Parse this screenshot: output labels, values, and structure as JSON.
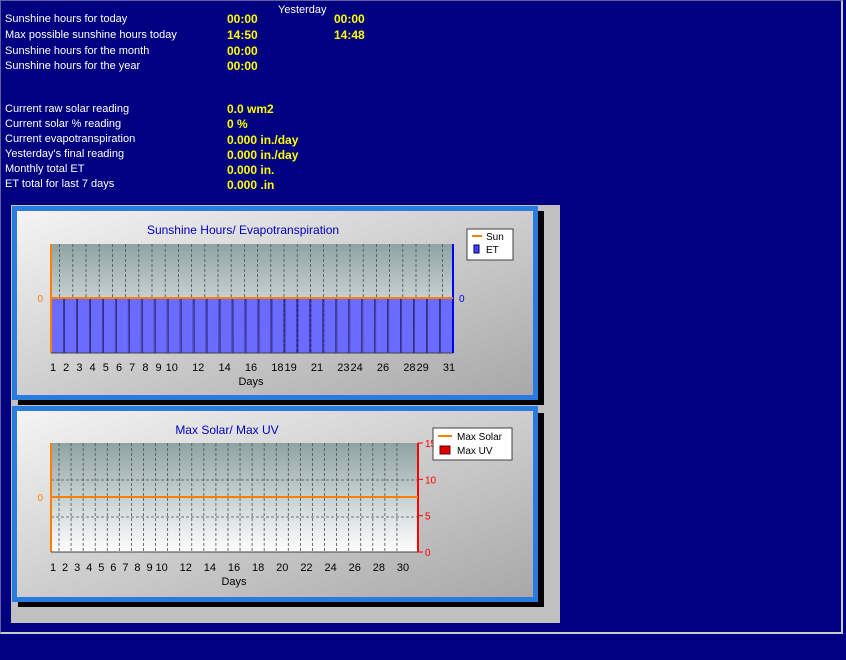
{
  "header": {
    "yesterday_label": "Yesterday"
  },
  "stats": [
    {
      "label": "Sunshine hours for today",
      "value": "00:00",
      "yesterday": "00:00"
    },
    {
      "label": "Max possible sunshine hours today",
      "value": "14:50",
      "yesterday": "14:48"
    },
    {
      "label": "Sunshine hours for the month",
      "value": "00:00"
    },
    {
      "label": "Sunshine hours for the year",
      "value": "00:00"
    }
  ],
  "solar": [
    {
      "label": "Current raw solar reading",
      "value": "0.0 wm2"
    },
    {
      "label": "Current solar % reading",
      "value": "0 %"
    },
    {
      "label": "Current evapotranspiration",
      "value": "0.000 in./day"
    },
    {
      "label": "Yesterday's final reading",
      "value": "0.000 in./day"
    },
    {
      "label": "Monthly total ET",
      "value": "0.000 in."
    },
    {
      "label": "ET total for last 7 days",
      "value": "0.000 .in"
    }
  ],
  "colors": {
    "background": "#000080",
    "value": "#ffff00",
    "sun": "#ff8000",
    "et": "#6b6bff",
    "uv": "#e00000",
    "title": "#0000c0"
  },
  "chart_data": [
    {
      "type": "bar",
      "title": "Sunshine Hours/ Evapotranspiration",
      "xlabel": "Days",
      "x_ticks": [
        "1",
        "2",
        "3",
        "4",
        "5",
        "6",
        "7",
        "8",
        "9",
        "10",
        "12",
        "14",
        "16",
        "18",
        "19",
        "21",
        "23",
        "24",
        "26",
        "28",
        "29",
        "31"
      ],
      "left_axis_tick": "0",
      "right_axis_tick": "0",
      "legend": [
        "Sun",
        "ET"
      ],
      "legend_position": "top-right",
      "series": [
        {
          "name": "Sun",
          "kind": "line",
          "values": [
            0,
            0,
            0,
            0,
            0,
            0,
            0,
            0,
            0,
            0,
            0,
            0,
            0,
            0,
            0,
            0,
            0,
            0,
            0,
            0,
            0,
            0,
            0,
            0,
            0,
            0,
            0,
            0,
            0,
            0,
            0
          ]
        },
        {
          "name": "ET",
          "kind": "bar",
          "values": [
            0,
            0,
            0,
            0,
            0,
            0,
            0,
            0,
            0,
            0,
            0,
            0,
            0,
            0,
            0,
            0,
            0,
            0,
            0,
            0,
            0,
            0,
            0,
            0,
            0,
            0,
            0,
            0,
            0,
            0,
            0
          ]
        }
      ],
      "days": 31
    },
    {
      "type": "line",
      "title": "Max Solar/ Max UV",
      "xlabel": "Days",
      "x_ticks": [
        "1",
        "2",
        "3",
        "4",
        "5",
        "6",
        "7",
        "8",
        "9",
        "10",
        "12",
        "14",
        "16",
        "18",
        "20",
        "22",
        "24",
        "26",
        "28",
        "30"
      ],
      "left_axis_tick": "0",
      "right_axis_ticks": [
        "15",
        "10",
        "5",
        "0"
      ],
      "right_ylim": [
        0,
        15
      ],
      "legend": [
        "Max Solar",
        "Max UV"
      ],
      "legend_position": "top-right",
      "series": [
        {
          "name": "Max Solar",
          "values": [
            0,
            0,
            0,
            0,
            0,
            0,
            0,
            0,
            0,
            0,
            0,
            0,
            0,
            0,
            0,
            0,
            0,
            0,
            0,
            0,
            0,
            0,
            0,
            0,
            0,
            0,
            0,
            0,
            0,
            0
          ]
        },
        {
          "name": "Max UV",
          "values": [
            0,
            0,
            0,
            0,
            0,
            0,
            0,
            0,
            0,
            0,
            0,
            0,
            0,
            0,
            0,
            0,
            0,
            0,
            0,
            0,
            0,
            0,
            0,
            0,
            0,
            0,
            0,
            0,
            0,
            0
          ]
        }
      ],
      "days": 30
    }
  ]
}
